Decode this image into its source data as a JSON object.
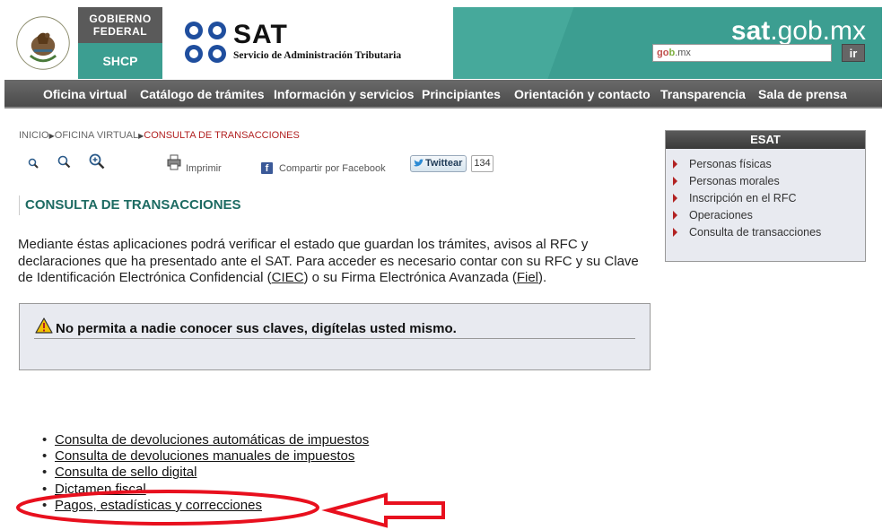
{
  "header": {
    "gobierno_label": "Gobierno Federal",
    "gobierno_line1": "GOBIERNO",
    "gobierno_line2": "FEDERAL",
    "shcp_label": "SHCP",
    "sat_logo_text": "SAT",
    "sat_subtitle": "Servicio de Administración Tributaria",
    "site_name_bold": "sat",
    "site_name_rest": ".gob.mx",
    "search": {
      "prefix_a": "go",
      "prefix_b": "b",
      "suffix": ".mx"
    },
    "search_button_label": "ir",
    "colors": {
      "teal": "#3c9e91",
      "dark_gray": "#5a5a5a"
    }
  },
  "nav": {
    "items": [
      {
        "label": "Oficina virtual"
      },
      {
        "label": "Catálogo de trámites"
      },
      {
        "label": "Información y servicios"
      },
      {
        "label": "Principiantes"
      },
      {
        "label": "Orientación y contacto"
      },
      {
        "label": "Transparencia"
      },
      {
        "label": "Sala de prensa"
      }
    ]
  },
  "breadcrumb": {
    "items": [
      "INICIO",
      "OFICINA VIRTUAL",
      "CONSULTA DE TRANSACCIONES"
    ]
  },
  "tools": {
    "zoom_icons": [
      "zoom-reset-icon",
      "zoom-out-icon",
      "zoom-in-icon"
    ],
    "print_label": "Imprimir",
    "facebook_label": "Compartir por Facebook",
    "twitter_label": "Twittear",
    "twitter_count": "134"
  },
  "main": {
    "title": "CONSULTA DE TRANSACCIONES",
    "intro_before_ciec": "Mediante éstas aplicaciones podrá verificar el estado que guardan los trámites, avisos al RFC y declaraciones que ha presentado ante el SAT. Para acceder es necesario contar con su RFC y su Clave de Identificación Electrónica Confidencial (",
    "intro_ciec_link": "CIEC",
    "intro_middle": ") o su Firma Electrónica Avanzada (",
    "intro_fiel_link": "Fiel",
    "intro_end": ").",
    "warning": "No permita a nadie conocer sus claves, digítelas usted mismo.",
    "links": [
      {
        "label": "Consulta de devoluciones automáticas de impuestos"
      },
      {
        "label": "Consulta de devoluciones manuales de impuestos"
      },
      {
        "label": "Consulta de sello digital"
      },
      {
        "label": "Dictamen fiscal"
      },
      {
        "label": "Pagos, estadísticas y correcciones"
      }
    ]
  },
  "esat": {
    "title": "ESAT",
    "items": [
      {
        "label": "Personas físicas"
      },
      {
        "label": "Personas morales"
      },
      {
        "label": "Inscripción en el RFC"
      },
      {
        "label": "Operaciones"
      },
      {
        "label": "Consulta de transacciones"
      }
    ]
  },
  "annotation": {
    "color": "#e8101e",
    "highlighted_item": "Pagos, estadísticas y correcciones"
  }
}
